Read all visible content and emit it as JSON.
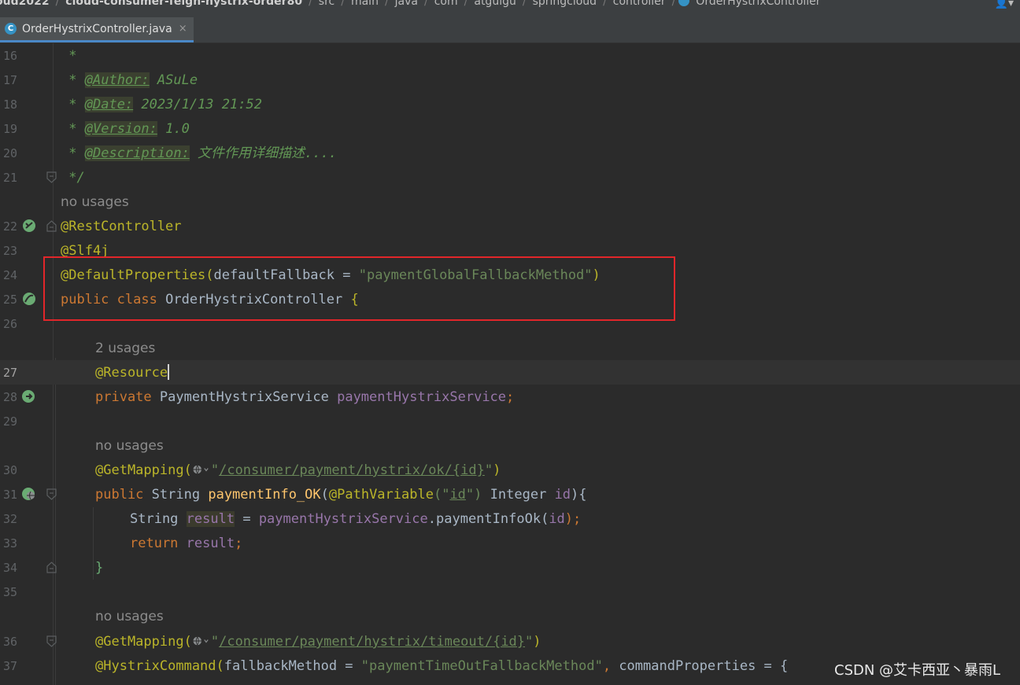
{
  "breadcrumb": {
    "items": [
      "oud2022",
      "cloud-consumer-feign-hystrix-order80",
      "src",
      "main",
      "java",
      "com",
      "atguigu",
      "springcloud",
      "controller",
      "OrderHystrixController"
    ],
    "separator": "/",
    "user_menu": "👤▾"
  },
  "tab": {
    "file_icon": "C",
    "label": "OrderHystrixController.java",
    "close": "×"
  },
  "hints": {
    "no_usages": "no usages",
    "two_usages": "2 usages"
  },
  "lines": {
    "n16": "16",
    "n17": "17",
    "n18": "18",
    "n19": "19",
    "n20": "20",
    "n21": "21",
    "n22": "22",
    "n23": "23",
    "n24": "24",
    "n25": "25",
    "n26": "26",
    "n27": "27",
    "n28": "28",
    "n29": "29",
    "n30": "30",
    "n31": "31",
    "n32": "32",
    "n33": "33",
    "n34": "34",
    "n35": "35",
    "n36": "36",
    "n37": "37"
  },
  "code": {
    "star": "*",
    "author_tag": "@Author:",
    "author_val": " ASuLe",
    "date_tag": "@Date:",
    "date_val": " 2023/1/13 21:52",
    "version_tag": "@Version:",
    "version_val": " 1.0",
    "desc_tag": "@Description:",
    "desc_val": " 文件作用详细描述....",
    "end_comment": "*/",
    "rest_controller": "@RestController",
    "slf4j": "@Slf4j",
    "default_props": "@DefaultProperties",
    "open_paren": "(",
    "close_paren": ")",
    "default_fallback_attr": "defaultFallback = ",
    "default_fallback_val": "\"paymentGlobalFallbackMethod\"",
    "public": "public",
    "class_kw": "class",
    "class_name": "OrderHystrixController",
    "open_brace": "{",
    "resource": "@Resource",
    "private": "private",
    "service_type": "PaymentHystrixService",
    "service_field": "paymentHystrixService",
    "semicolon": ";",
    "get_mapping": "@GetMapping",
    "quote": "\"",
    "ok_path": "/consumer/payment/hystrix/ok/{id}",
    "string_type": "String",
    "info_ok_method": "paymentInfo_OK",
    "path_variable": "@PathVariable",
    "id_str_open": "(\"",
    "id_val": "id",
    "id_str_close": "\")",
    "integer_type": "Integer",
    "id_param": "id",
    "paren_brace": "){",
    "result_var": "result",
    "assign": " = ",
    "dot": ".",
    "info_ok_call": "paymentInfoOk",
    "close_stmt": ");",
    "return_kw": "return",
    "close_brace": "}",
    "timeout_path": "/consumer/payment/hystrix/timeout/{id}",
    "hystrix_command": "@HystrixCommand",
    "fallback_method_attr": "fallbackMethod = ",
    "fallback_method_val": "\"paymentTimeOutFallbackMethod\"",
    "comma": ", ",
    "command_props_attr": "commandProperties = {"
  },
  "watermark": "CSDN @艾卡西亚丶暴雨L",
  "colors": {
    "background": "#2b2b2b",
    "keyword": "#cc7832",
    "annotation": "#bbb529",
    "string": "#6a8759",
    "field": "#9876aa",
    "comment": "#629755",
    "highlight_box": "#e2262a"
  }
}
